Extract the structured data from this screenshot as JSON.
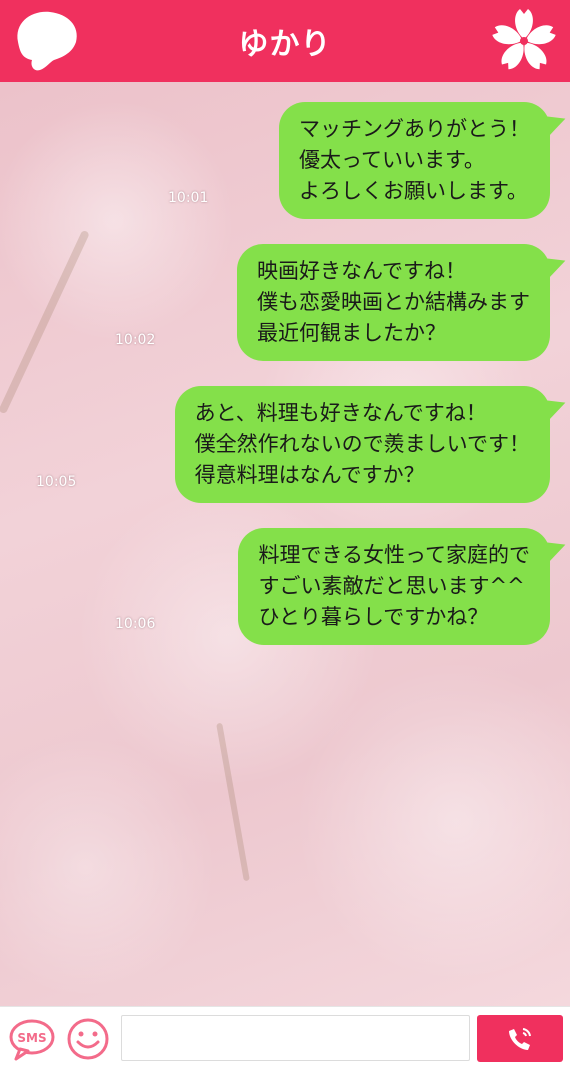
{
  "header": {
    "title": "ゆかり"
  },
  "colors": {
    "accent": "#f0305e",
    "bubble": "#84e04a"
  },
  "messages": [
    {
      "text": "マッチングありがとう！\n優太っていいます。\nよろしくお願いします。",
      "time": "10:01"
    },
    {
      "text": "映画好きなんですね！\n僕も恋愛映画とか結構みます\n最近何観ましたか？",
      "time": "10:02"
    },
    {
      "text": "あと、料理も好きなんですね！\n僕全然作れないので羨ましいです！\n得意料理はなんですか？",
      "time": "10:05"
    },
    {
      "text": "料理できる女性って家庭的で\nすごい素敵だと思います^^\nひとり暮らしですかね？",
      "time": "10:06"
    }
  ],
  "input_bar": {
    "sms_icon_label": "SMS",
    "message_value": "",
    "message_placeholder": ""
  },
  "icons": [
    "avatar-icon",
    "sakura-icon",
    "sms-icon",
    "smile-icon",
    "phone-icon"
  ]
}
